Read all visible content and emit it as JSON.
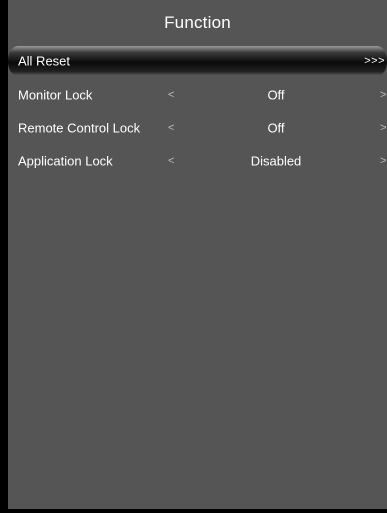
{
  "title": "Function",
  "menu": {
    "all_reset": {
      "label": "All Reset",
      "more": ">>>"
    },
    "items": [
      {
        "label": "Monitor Lock",
        "prev": "<",
        "value": "Off",
        "next": ">"
      },
      {
        "label": "Remote Control Lock",
        "prev": "<",
        "value": "Off",
        "next": ">"
      },
      {
        "label": "Application Lock",
        "prev": "<",
        "value": "Disabled",
        "next": ">"
      }
    ]
  },
  "colors": {
    "panel": "#555555",
    "frame": "#000000",
    "text": "#ffffff"
  }
}
